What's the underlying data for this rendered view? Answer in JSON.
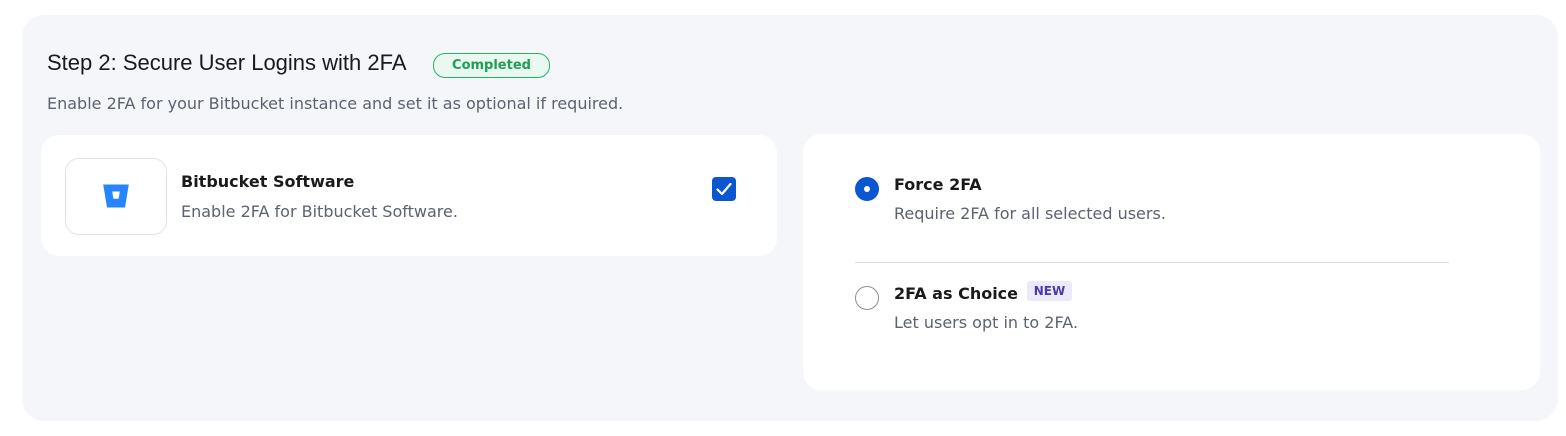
{
  "step": {
    "title": "Step 2: Secure User Logins with 2FA",
    "status": "Completed",
    "description": "Enable 2FA for your Bitbucket instance and set it as optional if required."
  },
  "product": {
    "name": "Bitbucket Software",
    "description": "Enable 2FA for Bitbucket Software.",
    "logo_icon": "bitbucket-logo-icon",
    "selected": true
  },
  "options": [
    {
      "title": "Force 2FA",
      "description": "Require 2FA for all selected users.",
      "selected": true
    },
    {
      "title": "2FA as Choice",
      "badge": "NEW",
      "description": "Let users opt in to 2FA.",
      "selected": false
    }
  ],
  "colors": {
    "accent": "#0b57d0",
    "completed_border": "#27b26a",
    "completed_text": "#1f9d55",
    "completed_bg": "#e9f9f0",
    "new_badge_bg": "#ece9fb",
    "new_badge_text": "#4b3aa8",
    "panel_bg": "#f5f6fa",
    "bitbucket_blue": "#2684ff"
  }
}
